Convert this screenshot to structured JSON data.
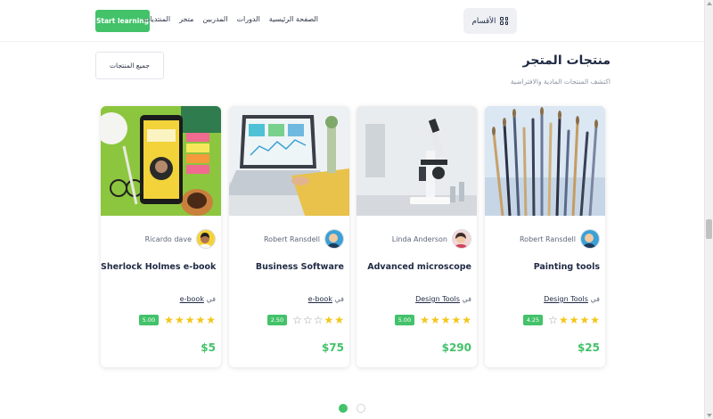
{
  "header": {
    "start_button": "Start learning",
    "nav": [
      "الصفحة الرئيسية",
      "الدورات",
      "المدربين",
      "متجر",
      "المنتديات"
    ],
    "categories_label": "الأقسام"
  },
  "section": {
    "title": "منتجات المتجر",
    "subtitle": "اكتشف المنتجات المادية والافتراضية",
    "all_button": "جميع المنتجات"
  },
  "category_prefix": "في",
  "products": [
    {
      "title": "Painting tools",
      "author": "Robert Ransdell",
      "category": "Design Tools",
      "rating": 4.25,
      "rating_label": "4.25",
      "stars": 4,
      "price": "$25",
      "image_icon": "paint-brushes-image"
    },
    {
      "title": "Advanced microscope",
      "author": "Linda Anderson",
      "category": "Design Tools",
      "rating": 5.0,
      "rating_label": "5.00",
      "stars": 5,
      "price": "$290",
      "image_icon": "microscope-image"
    },
    {
      "title": "Business Software",
      "author": "Robert Ransdell",
      "category": "e-book",
      "rating": 2.5,
      "rating_label": "2.50",
      "stars": 2,
      "price": "$75",
      "image_icon": "laptop-image"
    },
    {
      "title": "Sherlock Holmes e-book",
      "author": "Ricardo dave",
      "category": "e-book",
      "rating": 5.0,
      "rating_label": "5.00",
      "stars": 5,
      "price": "$5",
      "image_icon": "ebook-tablet-image"
    }
  ],
  "pagination": {
    "pages": 2,
    "active": 1
  },
  "colors": {
    "accent": "#43c26a",
    "star": "#f5c518",
    "text": "#1f2a44"
  }
}
